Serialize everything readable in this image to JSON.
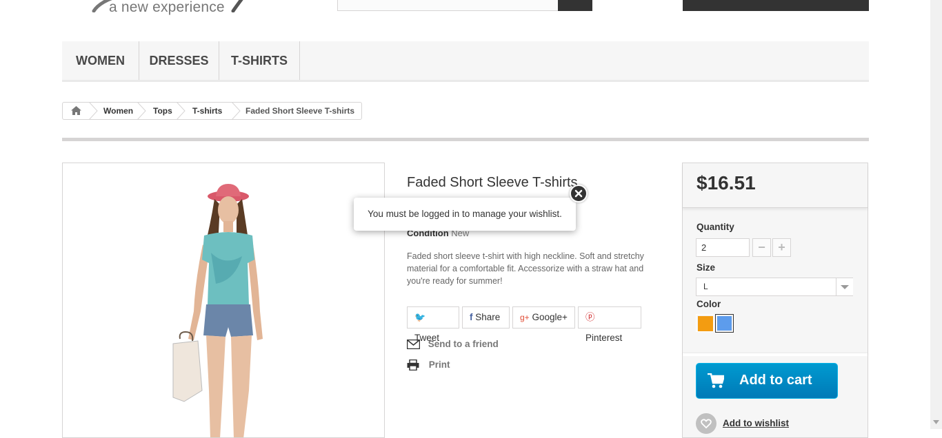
{
  "header": {
    "logo_tagline": "a new experience"
  },
  "menu": {
    "items": [
      {
        "label": "WOMEN"
      },
      {
        "label": "DRESSES"
      },
      {
        "label": "T-SHIRTS"
      }
    ]
  },
  "breadcrumb": {
    "items": [
      "Women",
      "Tops",
      "T-shirts"
    ],
    "current": "Faded Short Sleeve T-shirts"
  },
  "product": {
    "title": "Faded Short Sleeve T-shirts",
    "condition_label": "Condition",
    "condition_value": "New",
    "description": "Faded short sleeve t-shirt with high neckline. Soft and stretchy material for a comfortable fit. Accessorize with a straw hat and you're ready for summer!",
    "social": {
      "tweet": "Tweet",
      "share": "Share",
      "google": "Google+",
      "pinterest": "Pinterest"
    },
    "send_to_friend": "Send to a friend",
    "print": "Print"
  },
  "popup": {
    "message": "You must be logged in to manage your wishlist."
  },
  "buy_box": {
    "price": "$16.51",
    "quantity_label": "Quantity",
    "quantity_value": "2",
    "size_label": "Size",
    "size_value": "L",
    "color_label": "Color",
    "colors": [
      "#f39c11",
      "#5d9cec"
    ],
    "add_to_cart": "Add to cart",
    "add_to_wishlist": "Add to wishlist"
  }
}
